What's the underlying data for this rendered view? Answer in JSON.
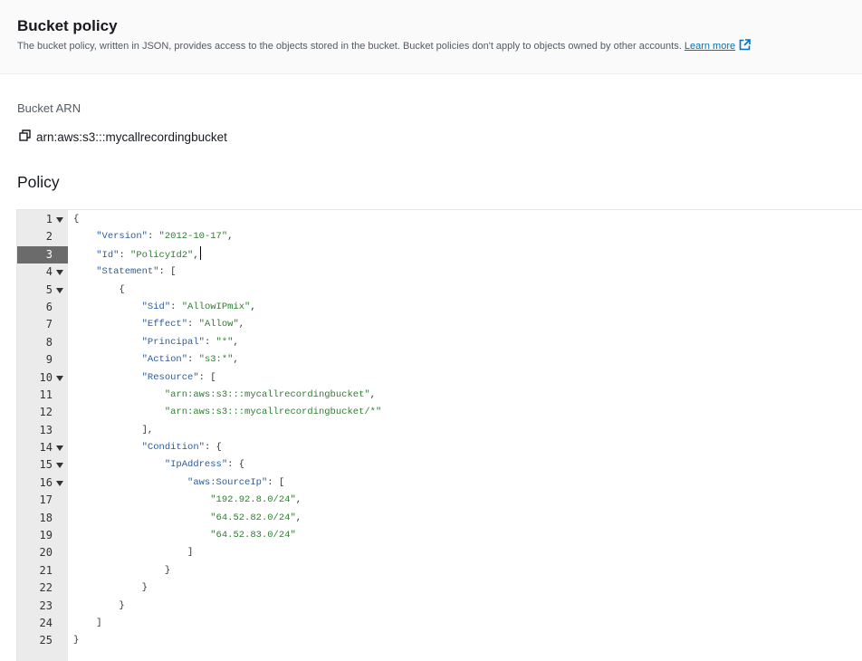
{
  "header": {
    "title": "Bucket policy",
    "description": "The bucket policy, written in JSON, provides access to the objects stored in the bucket. Bucket policies don't apply to objects owned by other accounts.",
    "learn_more_label": "Learn more"
  },
  "bucket_arn": {
    "label": "Bucket ARN",
    "value": "arn:aws:s3:::mycallrecordingbucket",
    "copy_icon": "copy-icon"
  },
  "policy": {
    "heading": "Policy",
    "active_line": 3,
    "lines": [
      {
        "n": "1",
        "fold": true,
        "indent": 0,
        "tokens": [
          {
            "t": "punc",
            "v": "{"
          }
        ]
      },
      {
        "n": "2",
        "fold": false,
        "indent": 1,
        "tokens": [
          {
            "t": "key",
            "v": "\"Version\""
          },
          {
            "t": "punc",
            "v": ": "
          },
          {
            "t": "str",
            "v": "\"2012-10-17\""
          },
          {
            "t": "punc",
            "v": ","
          }
        ]
      },
      {
        "n": "3",
        "fold": false,
        "indent": 1,
        "tokens": [
          {
            "t": "key",
            "v": "\"Id\""
          },
          {
            "t": "punc",
            "v": ": "
          },
          {
            "t": "str",
            "v": "\"PolicyId2\""
          },
          {
            "t": "punc",
            "v": ","
          }
        ],
        "caret": true
      },
      {
        "n": "4",
        "fold": true,
        "indent": 1,
        "tokens": [
          {
            "t": "key",
            "v": "\"Statement\""
          },
          {
            "t": "punc",
            "v": ": ["
          }
        ]
      },
      {
        "n": "5",
        "fold": true,
        "indent": 2,
        "tokens": [
          {
            "t": "punc",
            "v": "{"
          }
        ]
      },
      {
        "n": "6",
        "fold": false,
        "indent": 3,
        "tokens": [
          {
            "t": "key",
            "v": "\"Sid\""
          },
          {
            "t": "punc",
            "v": ": "
          },
          {
            "t": "str",
            "v": "\"AllowIPmix\""
          },
          {
            "t": "punc",
            "v": ","
          }
        ]
      },
      {
        "n": "7",
        "fold": false,
        "indent": 3,
        "tokens": [
          {
            "t": "key",
            "v": "\"Effect\""
          },
          {
            "t": "punc",
            "v": ": "
          },
          {
            "t": "str",
            "v": "\"Allow\""
          },
          {
            "t": "punc",
            "v": ","
          }
        ]
      },
      {
        "n": "8",
        "fold": false,
        "indent": 3,
        "tokens": [
          {
            "t": "key",
            "v": "\"Principal\""
          },
          {
            "t": "punc",
            "v": ": "
          },
          {
            "t": "str",
            "v": "\"*\""
          },
          {
            "t": "punc",
            "v": ","
          }
        ]
      },
      {
        "n": "9",
        "fold": false,
        "indent": 3,
        "tokens": [
          {
            "t": "key",
            "v": "\"Action\""
          },
          {
            "t": "punc",
            "v": ": "
          },
          {
            "t": "str",
            "v": "\"s3:*\""
          },
          {
            "t": "punc",
            "v": ","
          }
        ]
      },
      {
        "n": "10",
        "fold": true,
        "indent": 3,
        "tokens": [
          {
            "t": "key",
            "v": "\"Resource\""
          },
          {
            "t": "punc",
            "v": ": ["
          }
        ]
      },
      {
        "n": "11",
        "fold": false,
        "indent": 4,
        "tokens": [
          {
            "t": "str",
            "v": "\"arn:aws:s3:::mycallrecordingbucket\""
          },
          {
            "t": "punc",
            "v": ","
          }
        ]
      },
      {
        "n": "12",
        "fold": false,
        "indent": 4,
        "tokens": [
          {
            "t": "str",
            "v": "\"arn:aws:s3:::mycallrecordingbucket/*\""
          }
        ]
      },
      {
        "n": "13",
        "fold": false,
        "indent": 3,
        "tokens": [
          {
            "t": "punc",
            "v": "],"
          }
        ]
      },
      {
        "n": "14",
        "fold": true,
        "indent": 3,
        "tokens": [
          {
            "t": "key",
            "v": "\"Condition\""
          },
          {
            "t": "punc",
            "v": ": {"
          }
        ]
      },
      {
        "n": "15",
        "fold": true,
        "indent": 4,
        "tokens": [
          {
            "t": "key",
            "v": "\"IpAddress\""
          },
          {
            "t": "punc",
            "v": ": {"
          }
        ]
      },
      {
        "n": "16",
        "fold": true,
        "indent": 5,
        "tokens": [
          {
            "t": "key",
            "v": "\"aws:SourceIp\""
          },
          {
            "t": "punc",
            "v": ": ["
          }
        ]
      },
      {
        "n": "17",
        "fold": false,
        "indent": 6,
        "tokens": [
          {
            "t": "str",
            "v": "\"192.92.8.0/24\""
          },
          {
            "t": "punc",
            "v": ","
          }
        ]
      },
      {
        "n": "18",
        "fold": false,
        "indent": 6,
        "tokens": [
          {
            "t": "str",
            "v": "\"64.52.82.0/24\""
          },
          {
            "t": "punc",
            "v": ","
          }
        ]
      },
      {
        "n": "19",
        "fold": false,
        "indent": 6,
        "tokens": [
          {
            "t": "str",
            "v": "\"64.52.83.0/24\""
          }
        ]
      },
      {
        "n": "20",
        "fold": false,
        "indent": 5,
        "tokens": [
          {
            "t": "punc",
            "v": "]"
          }
        ]
      },
      {
        "n": "21",
        "fold": false,
        "indent": 4,
        "tokens": [
          {
            "t": "punc",
            "v": "}"
          }
        ]
      },
      {
        "n": "22",
        "fold": false,
        "indent": 3,
        "tokens": [
          {
            "t": "punc",
            "v": "}"
          }
        ]
      },
      {
        "n": "23",
        "fold": false,
        "indent": 2,
        "tokens": [
          {
            "t": "punc",
            "v": "}"
          }
        ]
      },
      {
        "n": "24",
        "fold": false,
        "indent": 1,
        "tokens": [
          {
            "t": "punc",
            "v": "]"
          }
        ]
      },
      {
        "n": "25",
        "fold": false,
        "indent": 0,
        "tokens": [
          {
            "t": "punc",
            "v": "}"
          }
        ]
      }
    ]
  }
}
